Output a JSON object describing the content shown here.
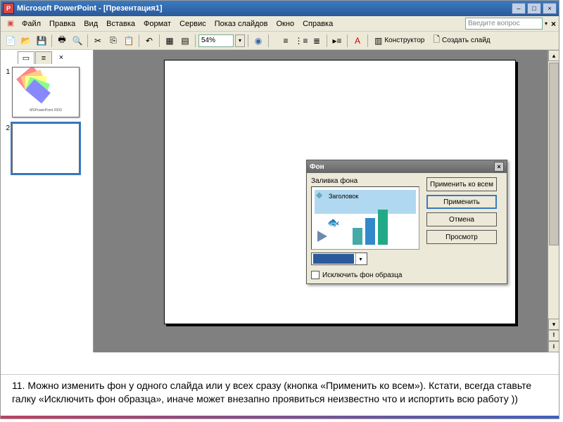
{
  "titlebar": {
    "app": "Microsoft PowerPoint",
    "doc": "[Презентация1]"
  },
  "menubar": {
    "items": [
      "Файл",
      "Правка",
      "Вид",
      "Вставка",
      "Формат",
      "Сервис",
      "Показ слайдов",
      "Окно",
      "Справка"
    ],
    "help_placeholder": "Введите вопрос"
  },
  "toolbar": {
    "zoom": "54%",
    "designer": "Конструктор",
    "new_slide": "Создать слайд"
  },
  "view_tabs": {
    "close": "×"
  },
  "thumbnails": [
    {
      "num": "1",
      "selected": false
    },
    {
      "num": "2",
      "selected": true
    }
  ],
  "dialog": {
    "title": "Фон",
    "fill_label": "Заливка фона",
    "preview_title": "Заголовок",
    "apply_all": "Применить ко всем",
    "apply": "Применить",
    "cancel": "Отмена",
    "preview": "Просмотр",
    "exclude_master": "Исключить фон образца"
  },
  "caption": "11.   Можно изменить фон у одного слайда или у всех сразу (кнопка «Применить ко всем»). Кстати, всегда ставьте галку «Исключить фон образца», иначе может внезапно проявиться неизвестно что и испортить всю работу ))"
}
